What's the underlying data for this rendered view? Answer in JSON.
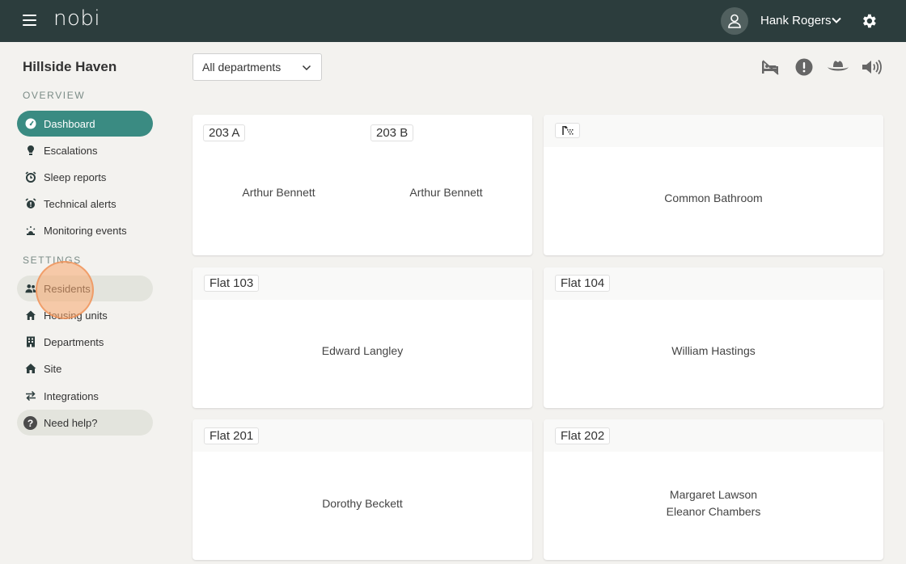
{
  "header": {
    "logo": "nobi",
    "user_name": "Hank Rogers"
  },
  "sidebar": {
    "site_name": "Hillside Haven",
    "overview_label": "OVERVIEW",
    "settings_label": "SETTINGS",
    "overview_items": [
      {
        "label": "Dashboard",
        "icon": "dashboard-icon"
      },
      {
        "label": "Escalations",
        "icon": "escalation-icon"
      },
      {
        "label": "Sleep reports",
        "icon": "alarm-clock-icon"
      },
      {
        "label": "Technical alerts",
        "icon": "technical-alert-icon"
      },
      {
        "label": "Monitoring events",
        "icon": "monitoring-icon"
      }
    ],
    "settings_items": [
      {
        "label": "Residents",
        "icon": "users-icon"
      },
      {
        "label": "Housing units",
        "icon": "housing-icon"
      },
      {
        "label": "Departments",
        "icon": "building-icon"
      },
      {
        "label": "Site",
        "icon": "home-icon"
      },
      {
        "label": "Integrations",
        "icon": "swap-icon"
      }
    ],
    "help_label": "Need help?"
  },
  "toolbar": {
    "department_value": "All departments"
  },
  "cards": [
    {
      "units": [
        {
          "name": "203 A",
          "resident": "Arthur Bennett"
        },
        {
          "name": "203 B",
          "resident": "Arthur Bennett"
        }
      ]
    },
    {
      "icon": "shower-icon",
      "resident": "Common Bathroom"
    },
    {
      "unit": "Flat 103",
      "resident": "Edward Langley"
    },
    {
      "unit": "Flat 104",
      "resident": "William Hastings"
    },
    {
      "unit": "Flat 201",
      "resident": "Dorothy Beckett"
    },
    {
      "unit": "Flat 202",
      "residents": [
        "Margaret Lawson",
        "Eleanor Chambers"
      ]
    }
  ],
  "colors": {
    "topbar": "#2c3d3d",
    "accent": "#3a8b82",
    "background": "#f3f2ef"
  }
}
